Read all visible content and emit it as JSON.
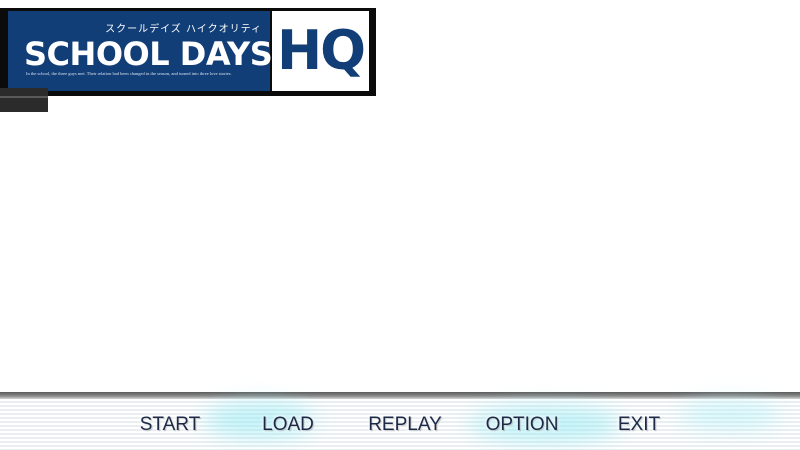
{
  "logo": {
    "japanese_title": "スクールデイズ ハイクオリティ",
    "title": "SCHOOL DAYS",
    "tagline": "In the school, the three guys met. Their relation had been changed in the season, and turned into three love stories.",
    "edition": "HQ",
    "colors": {
      "navy": "#123e77",
      "frame": "#0b0b0b"
    }
  },
  "menu": {
    "items": [
      {
        "label": "START"
      },
      {
        "label": "LOAD"
      },
      {
        "label": "REPLAY"
      },
      {
        "label": "OPTION"
      },
      {
        "label": "EXIT"
      }
    ],
    "colors": {
      "text": "#1c2a48",
      "glow": "#8ee6f0"
    }
  }
}
